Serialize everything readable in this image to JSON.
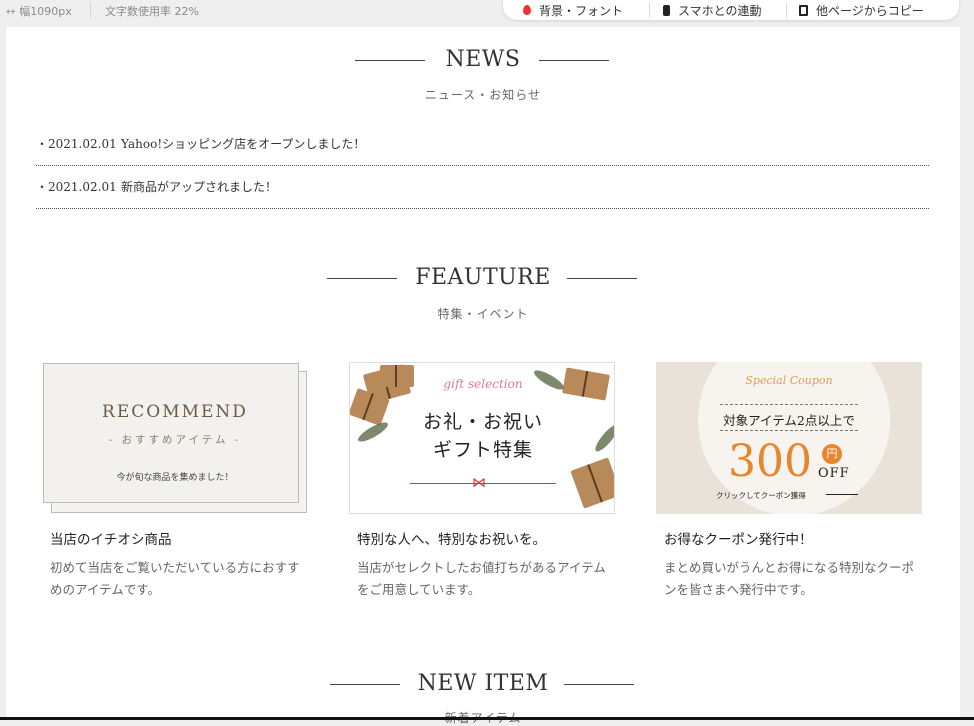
{
  "toolbar": {
    "width_label": "幅1090px",
    "char_rate": "文字数使用率 22%",
    "btn_bg_font": "背景・フォント",
    "btn_smartphone": "スマホとの連動",
    "btn_copy": "他ページからコピー",
    "icons": [
      "arrows-horizontal-icon",
      "droplet-icon",
      "smartphone-icon",
      "copy-icon"
    ]
  },
  "news": {
    "title": "NEWS",
    "subtitle": "ニュース・お知らせ",
    "items": [
      {
        "date": "・2021.02.01",
        "text": "Yahoo!ショッピング店をオープンしました！"
      },
      {
        "date": "・2021.02.01",
        "text": "新商品がアップされました！"
      }
    ]
  },
  "feature": {
    "title": "FEAUTURE",
    "subtitle": "特集・イベント",
    "cards": [
      {
        "title": "当店のイチオシ商品",
        "desc": "初めて当店をご覧いただいている方におすすめのアイテムです。",
        "img_line1": "RECOMMEND",
        "img_line2": "- おすすめアイテム -",
        "img_line3": "今が旬な商品を集めました！"
      },
      {
        "title": "特別な人へ、特別なお祝いを。",
        "desc": "当店がセレクトしたお値打ちがあるアイテムをご用意しています。",
        "img_line1": "gift selection",
        "img_line2": "お礼・お祝い",
        "img_line3": "ギフト特集"
      },
      {
        "title": "お得なクーポン発行中！",
        "desc": "まとめ買いがうんとお得になる特別なクーポンを皆さまへ発行中です。",
        "img_line1": "Special Coupon",
        "img_line2": "対象アイテム2点以上で",
        "img_amount": "300",
        "img_yen": "円",
        "img_off": "OFF",
        "img_line3": "クリックしてクーポン獲得"
      }
    ]
  },
  "new_item": {
    "title": "NEW ITEM",
    "subtitle": "新着アイテム"
  }
}
